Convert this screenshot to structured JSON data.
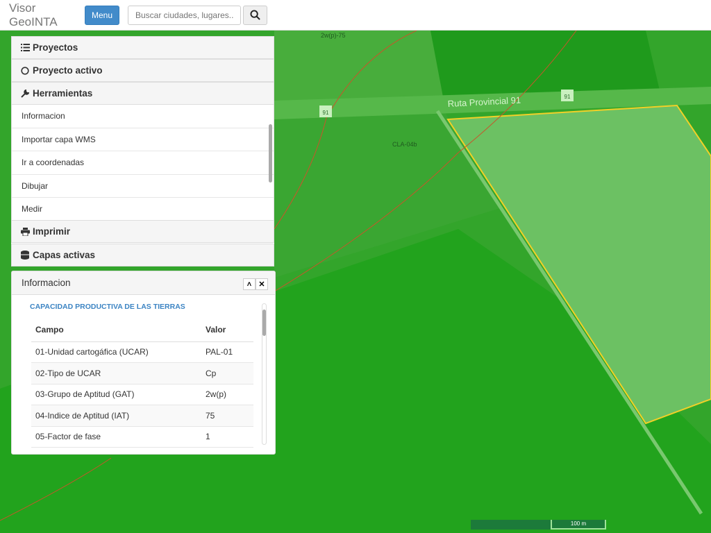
{
  "header": {
    "brand": "Visor GeoINTA",
    "menu_label": "Menu",
    "search_placeholder": "Buscar ciudades, lugares...",
    "search_icon": "search-icon"
  },
  "accordion": {
    "items": [
      {
        "label": "Proyectos",
        "icon": "list-icon"
      },
      {
        "label": "Proyecto activo",
        "icon": "circle-icon"
      },
      {
        "label": "Herramientas",
        "icon": "wrench-icon"
      },
      {
        "label": "Imprimir",
        "icon": "print-icon"
      },
      {
        "label": "Capas activas",
        "icon": "database-icon"
      }
    ],
    "tools": [
      "Informacion",
      "Importar capa WMS",
      "Ir a coordenadas",
      "Dibujar",
      "Medir"
    ]
  },
  "info": {
    "title": "Informacion",
    "subtitle": "CAPACIDAD PRODUCTIVA DE LAS TIERRAS",
    "columns": [
      "Campo",
      "Valor"
    ],
    "rows": [
      [
        "01-Unidad cartogáfica (UCAR)",
        "PAL-01"
      ],
      [
        "02-Tipo de UCAR",
        "Cp"
      ],
      [
        "03-Grupo de Aptitud (GAT)",
        "2w(p)"
      ],
      [
        "04-Indice de Aptitud (IAT)",
        "75"
      ],
      [
        "05-Factor de fase",
        "1"
      ]
    ]
  },
  "map": {
    "road_label": "Ruta Provincial 91",
    "shield": "91",
    "label_top": "2w(p)-75",
    "label_mid": "CLA-04b",
    "scale": "100 m",
    "colors": {
      "parcel_outline": "#f2d027",
      "soil_line": "#c8552a"
    }
  }
}
